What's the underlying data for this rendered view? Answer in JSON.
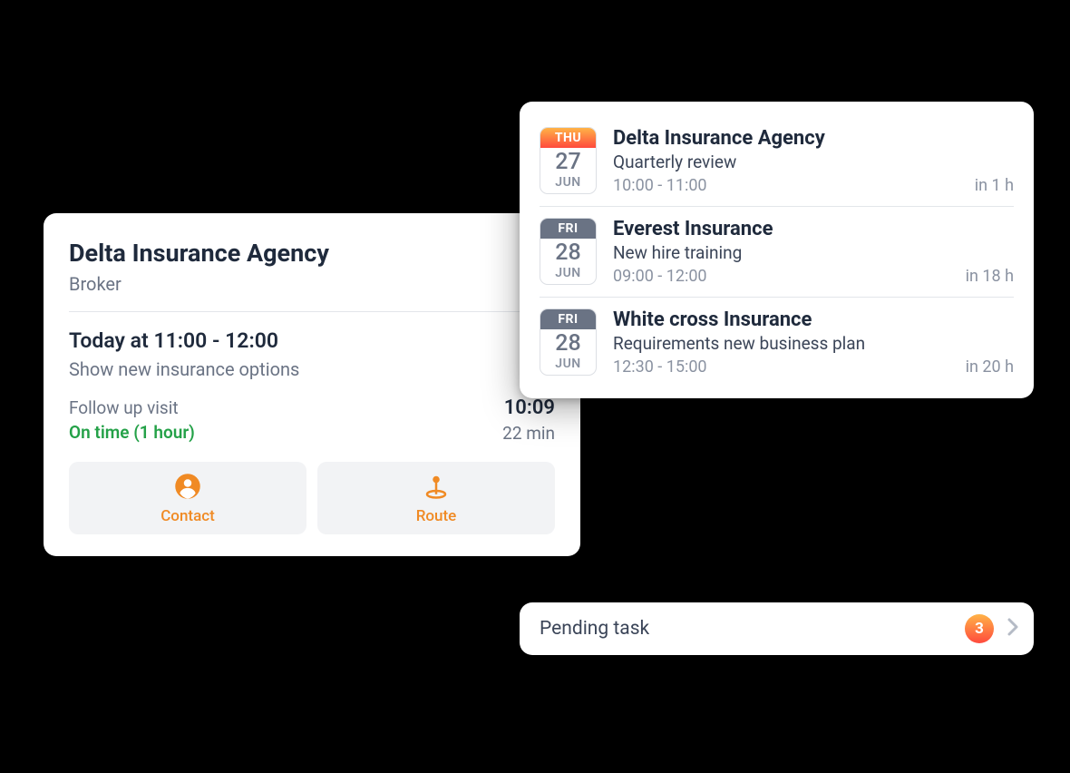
{
  "detail": {
    "title": "Delta Insurance Agency",
    "role": "Broker",
    "time_label": "Today at 11:00 - 12:00",
    "subject": "Show new insurance options",
    "follow_label": "Follow up visit",
    "status": "On time (1 hour)",
    "clock": "10:09",
    "mins": "22 min",
    "actions": {
      "contact": "Contact",
      "route": "Route"
    }
  },
  "schedule": [
    {
      "dow": "THU",
      "day": "27",
      "month": "JUN",
      "today": true,
      "title": "Delta Insurance Agency",
      "subject": "Quarterly review",
      "range": "10:00 - 11:00",
      "eta": "in 1 h"
    },
    {
      "dow": "FRI",
      "day": "28",
      "month": "JUN",
      "today": false,
      "title": "Everest Insurance",
      "subject": "New hire training",
      "range": "09:00 - 12:00",
      "eta": "in 18 h"
    },
    {
      "dow": "FRI",
      "day": "28",
      "month": "JUN",
      "today": false,
      "title": "White cross Insurance",
      "subject": "Requirements new business plan",
      "range": "12:30 - 15:00",
      "eta": "in 20 h"
    }
  ],
  "pending": {
    "label": "Pending task",
    "count": "3"
  }
}
